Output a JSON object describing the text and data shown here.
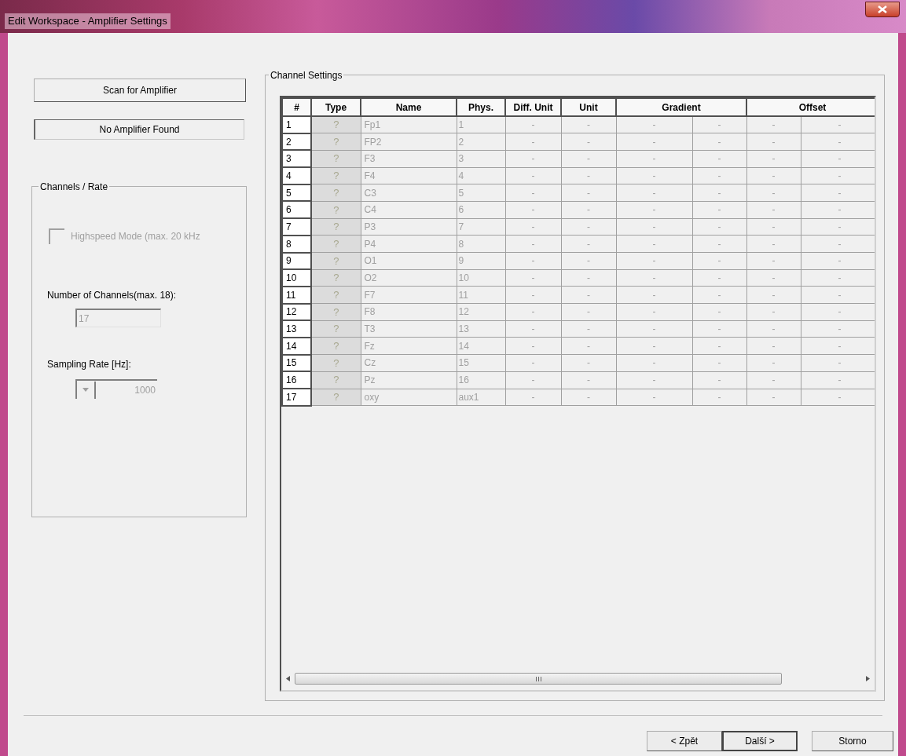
{
  "window": {
    "title": "Edit Workspace - Amplifier Settings"
  },
  "scan_button": {
    "label": "Scan for Amplifier"
  },
  "amplifier_status": "No Amplifier Found",
  "channels_rate": {
    "title": "Channels / Rate",
    "highspeed": {
      "label": "Highspeed Mode (max. 20 kHz",
      "checked": false,
      "disabled": true
    },
    "channels_label": "Number of Channels(max. 18):",
    "channels_field": {
      "value": "17",
      "disabled": true
    },
    "rate_label": "Sampling Rate [Hz]:",
    "rate_dropdown": {
      "value": "1000",
      "disabled": true
    }
  },
  "channel_settings": {
    "title": "Channel Settings",
    "columns": [
      {
        "label": "#",
        "kind": "single"
      },
      {
        "label": "Type",
        "kind": "single"
      },
      {
        "label": "Name",
        "kind": "single"
      },
      {
        "label": "Phys.",
        "kind": "single"
      },
      {
        "label": "Diff. Unit",
        "kind": "single"
      },
      {
        "label": "Unit",
        "kind": "single"
      },
      {
        "label": "Gradient",
        "kind": "pair"
      },
      {
        "label": "Offset",
        "kind": "pair"
      }
    ],
    "rows": [
      {
        "num": "1",
        "type": "?",
        "name": "Fp1",
        "phys": "1",
        "values": [
          "-",
          "-",
          "-",
          "-",
          "-",
          "-"
        ]
      },
      {
        "num": "2",
        "type": "?",
        "name": "FP2",
        "phys": "2",
        "values": [
          "-",
          "-",
          "-",
          "-",
          "-",
          "-"
        ]
      },
      {
        "num": "3",
        "type": "?",
        "name": "F3",
        "phys": "3",
        "values": [
          "-",
          "-",
          "-",
          "-",
          "-",
          "-"
        ]
      },
      {
        "num": "4",
        "type": "?",
        "name": "F4",
        "phys": "4",
        "values": [
          "-",
          "-",
          "-",
          "-",
          "-",
          "-"
        ]
      },
      {
        "num": "5",
        "type": "?",
        "name": "C3",
        "phys": "5",
        "values": [
          "-",
          "-",
          "-",
          "-",
          "-",
          "-"
        ]
      },
      {
        "num": "6",
        "type": "?",
        "name": "C4",
        "phys": "6",
        "values": [
          "-",
          "-",
          "-",
          "-",
          "-",
          "-"
        ]
      },
      {
        "num": "7",
        "type": "?",
        "name": "P3",
        "phys": "7",
        "values": [
          "-",
          "-",
          "-",
          "-",
          "-",
          "-"
        ]
      },
      {
        "num": "8",
        "type": "?",
        "name": "P4",
        "phys": "8",
        "values": [
          "-",
          "-",
          "-",
          "-",
          "-",
          "-"
        ]
      },
      {
        "num": "9",
        "type": "?",
        "name": "O1",
        "phys": "9",
        "values": [
          "-",
          "-",
          "-",
          "-",
          "-",
          "-"
        ]
      },
      {
        "num": "10",
        "type": "?",
        "name": "O2",
        "phys": "10",
        "values": [
          "-",
          "-",
          "-",
          "-",
          "-",
          "-"
        ]
      },
      {
        "num": "11",
        "type": "?",
        "name": "F7",
        "phys": "11",
        "values": [
          "-",
          "-",
          "-",
          "-",
          "-",
          "-"
        ]
      },
      {
        "num": "12",
        "type": "?",
        "name": "F8",
        "phys": "12",
        "values": [
          "-",
          "-",
          "-",
          "-",
          "-",
          "-"
        ]
      },
      {
        "num": "13",
        "type": "?",
        "name": "T3",
        "phys": "13",
        "values": [
          "-",
          "-",
          "-",
          "-",
          "-",
          "-"
        ]
      },
      {
        "num": "14",
        "type": "?",
        "name": "Fz",
        "phys": "14",
        "values": [
          "-",
          "-",
          "-",
          "-",
          "-",
          "-"
        ]
      },
      {
        "num": "15",
        "type": "?",
        "name": "Cz",
        "phys": "15",
        "values": [
          "-",
          "-",
          "-",
          "-",
          "-",
          "-"
        ]
      },
      {
        "num": "16",
        "type": "?",
        "name": "Pz",
        "phys": "16",
        "values": [
          "-",
          "-",
          "-",
          "-",
          "-",
          "-"
        ]
      },
      {
        "num": "17",
        "type": "?",
        "name": "oxy",
        "phys": "aux1",
        "values": [
          "-",
          "-",
          "-",
          "-",
          "-",
          "-"
        ]
      }
    ]
  },
  "buttons": [
    {
      "label": "< Zpět",
      "default": false
    },
    {
      "label": "Další >",
      "default": true
    },
    {
      "label": "Storno",
      "default": false
    }
  ]
}
